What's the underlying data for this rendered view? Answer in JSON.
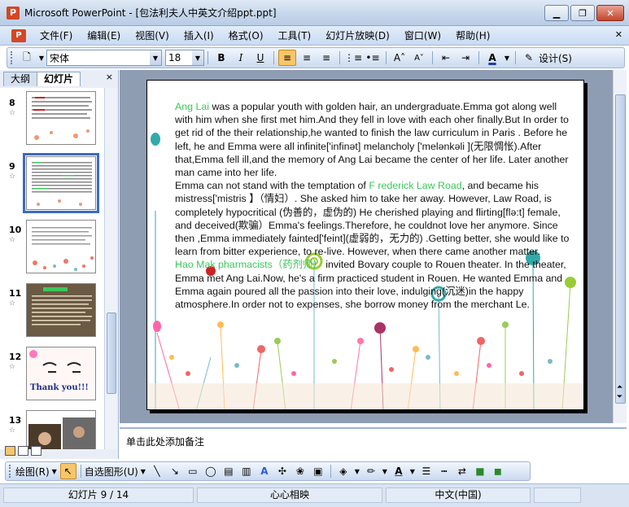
{
  "window": {
    "title": "Microsoft PowerPoint - [包法利夫人中英文介绍ppt.ppt]",
    "buttons": [
      "minimize",
      "maximize",
      "close"
    ]
  },
  "menu": {
    "items": [
      "文件(F)",
      "编辑(E)",
      "视图(V)",
      "插入(I)",
      "格式(O)",
      "工具(T)",
      "幻灯片放映(D)",
      "窗口(W)",
      "帮助(H)"
    ]
  },
  "toolbar": {
    "font_name": "宋体",
    "font_size": "18",
    "bold": "B",
    "italic": "I",
    "underline": "U",
    "design_label": "设计(S)"
  },
  "left_pane": {
    "tabs": [
      "大纲",
      "幻灯片"
    ],
    "active_tab": "幻灯片",
    "close": "×",
    "slides": [
      {
        "number": "8"
      },
      {
        "number": "9",
        "selected": true
      },
      {
        "number": "10"
      },
      {
        "number": "11"
      },
      {
        "number": "12",
        "caption": "Thank you!!!"
      },
      {
        "number": "13"
      }
    ]
  },
  "slide": {
    "paragraphs": [
      {
        "lead": "Ang Lai",
        "text": " was a popular youth with golden hair, an undergraduate.Emma got along well with him when she first met him.And they fell in love with each oher finally.But In order to get rid of the their relationship,he wanted to finish the law curriculum in Paris . Before he left, he and Emma were all infinite['infinət] melancholy ['melənkəli ](无限惆怅).After that,Emma fell ill,and the memory of Ang Lai became the center of her life. Later another man came into her life."
      },
      {
        "pre": "Emma can not stand with the temptation of ",
        "lead": "F rederick Law Road",
        "text": ", and became his mistress['mistris 】（情妇）. She asked him to take her away. However, Law Road, is completely hypocritical (伪善的，虚伪的) He cherished playing and flirting[flə:t] female, and deceived(欺骗）Emma's feelings.Therefore, he couldnot love her anymore. Since then ,Emma immediately fainted['feint](虚弱的，无力的) .Getting better, she would like to learn from bitter experience, to re-live.  However, when there came another matter."
      },
      {
        "lead": "Hao Mak pharmacists（药剂师）",
        "text": "  invited Bovary couple to Rouen theater.  In the theater, Emma met Ang Lai.Now, he's a firm practiced student in Rouen. He wanted Emma and Emma again poured all the passion into their love, indulging(沉迷)in the happy atmosphere.In order not to expenses, she borrow money from the merchant Le."
      }
    ]
  },
  "notes": {
    "placeholder": "单击此处添加备注"
  },
  "draw_toolbar": {
    "draw_label": "绘图(R)",
    "autoshapes_label": "自选图形(U)"
  },
  "status": {
    "slide_counter": "幻灯片 9 / 14",
    "theme": "心心相映",
    "language": "中文(中国)"
  },
  "colors": {
    "accent_green": "#3cc75a",
    "selection_blue": "#3b6bc1",
    "active_button": "#f7c66a"
  }
}
